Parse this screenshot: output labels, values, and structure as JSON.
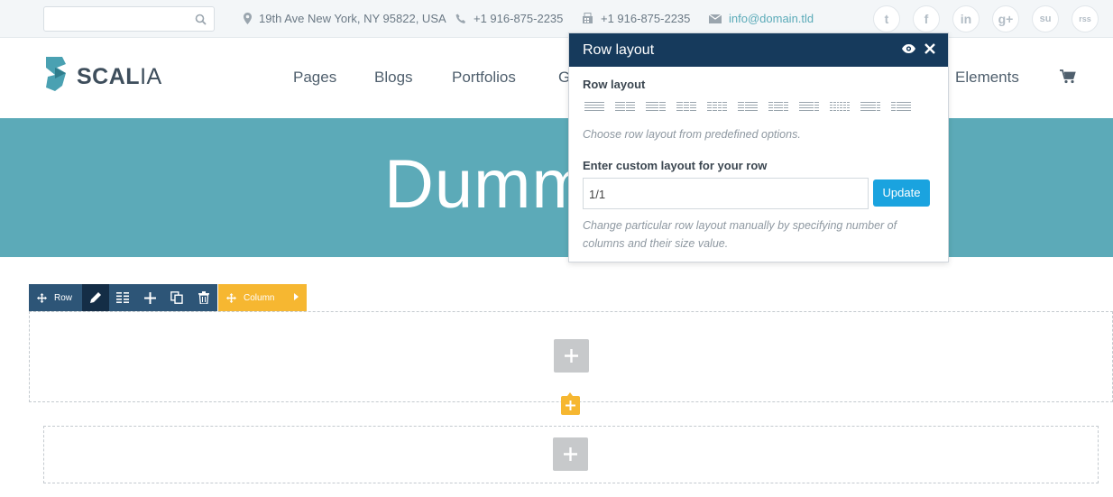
{
  "topbar": {
    "search_placeholder": "",
    "address": "19th Ave New York, NY 95822, USA",
    "phone": "+1 916-875-2235",
    "fax": "+1 916-875-2235",
    "email": "info@domain.tld",
    "social": [
      {
        "icon": "twitter-icon",
        "glyph": "t"
      },
      {
        "icon": "facebook-icon",
        "glyph": "f"
      },
      {
        "icon": "linkedin-icon",
        "glyph": "in"
      },
      {
        "icon": "google-plus-icon",
        "glyph": "g+"
      },
      {
        "icon": "stumbleupon-icon",
        "glyph": "su"
      },
      {
        "icon": "rss-icon",
        "glyph": "rss"
      }
    ]
  },
  "header": {
    "logo_bold": "SCAL",
    "logo_light": "IA",
    "nav": [
      "Pages",
      "Blogs",
      "Portfolios",
      "G",
      "Elements"
    ]
  },
  "hero": {
    "title": "Dumm"
  },
  "panel": {
    "title": "Row layout",
    "section_label": "Row layout",
    "layout_options": [
      [
        1
      ],
      [
        2
      ],
      [
        3
      ],
      [
        4
      ],
      [
        5
      ],
      [
        6
      ],
      [
        7
      ],
      [
        8
      ],
      [
        9
      ],
      [
        10
      ],
      [
        11
      ]
    ],
    "hint1": "Choose row layout from predefined options.",
    "custom_label": "Enter custom layout for your row",
    "custom_value": "1/1",
    "update_label": "Update",
    "hint2": "Change particular row layout manually by specifying number of columns and their size value."
  },
  "toolbar": {
    "row_label": "Row",
    "column_label": "Column"
  },
  "colors": {
    "navy": "#163a5c",
    "row_blue": "#2d5577",
    "accent_teal": "#5caab8",
    "yellow": "#f6b731",
    "update_blue": "#1aa3df"
  }
}
